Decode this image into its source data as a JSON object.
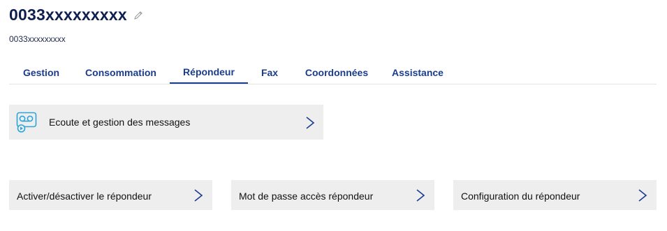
{
  "header": {
    "title": "0033xxxxxxxxx",
    "subtitle": "0033xxxxxxxxx"
  },
  "tabs": [
    {
      "label": "Gestion"
    },
    {
      "label": "Consommation"
    },
    {
      "label": "Répondeur",
      "active": true
    },
    {
      "label": "Fax"
    },
    {
      "label": "Coordonnées"
    },
    {
      "label": "Assistance"
    }
  ],
  "cards": {
    "messages": {
      "label": "Ecoute et gestion des messages",
      "icon": "voicemail-icon"
    },
    "activate": {
      "label": "Activer/désactiver le répondeur"
    },
    "password": {
      "label": "Mot de passe accès répondeur"
    },
    "config": {
      "label": "Configuration du répondeur"
    }
  },
  "colors": {
    "accent": "#1b3c8c",
    "title": "#0f1f4f",
    "card_bg": "#eeeeee",
    "icon": "#2aa6d9"
  }
}
